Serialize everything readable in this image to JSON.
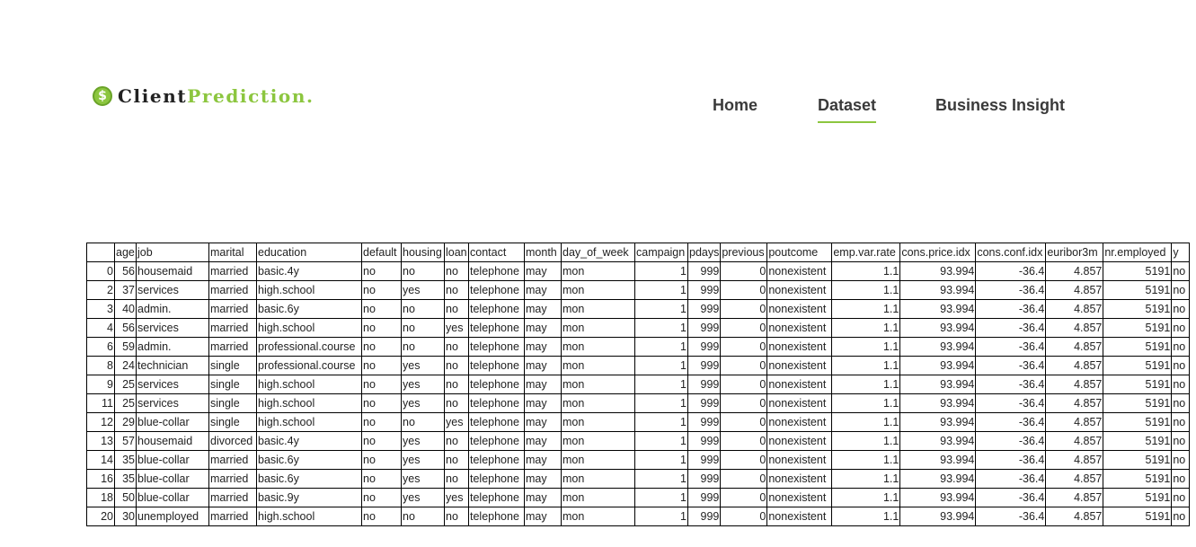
{
  "brand": {
    "part1": "Client",
    "part2": "Prediction.",
    "icon": "dollar-icon",
    "accent_color": "#8cc63f"
  },
  "nav": {
    "items": [
      {
        "label": "Home",
        "active": false
      },
      {
        "label": "Dataset",
        "active": true
      },
      {
        "label": "Business Insight",
        "active": false
      }
    ]
  },
  "table": {
    "columns": [
      "",
      "age",
      "job",
      "marital",
      "education",
      "default",
      "housing",
      "loan",
      "contact",
      "month",
      "day_of_week",
      "campaign",
      "pdays",
      "previous",
      "poutcome",
      "emp.var.rate",
      "cons.price.idx",
      "cons.conf.idx",
      "euribor3m",
      "nr.employed",
      "y"
    ],
    "rows": [
      [
        "0",
        "56",
        "housemaid",
        "married",
        "basic.4y",
        "no",
        "no",
        "no",
        "telephone",
        "may",
        "mon",
        "1",
        "999",
        "0",
        "nonexistent",
        "1.1",
        "93.994",
        "-36.4",
        "4.857",
        "5191",
        "no"
      ],
      [
        "2",
        "37",
        "services",
        "married",
        "high.school",
        "no",
        "yes",
        "no",
        "telephone",
        "may",
        "mon",
        "1",
        "999",
        "0",
        "nonexistent",
        "1.1",
        "93.994",
        "-36.4",
        "4.857",
        "5191",
        "no"
      ],
      [
        "3",
        "40",
        "admin.",
        "married",
        "basic.6y",
        "no",
        "no",
        "no",
        "telephone",
        "may",
        "mon",
        "1",
        "999",
        "0",
        "nonexistent",
        "1.1",
        "93.994",
        "-36.4",
        "4.857",
        "5191",
        "no"
      ],
      [
        "4",
        "56",
        "services",
        "married",
        "high.school",
        "no",
        "no",
        "yes",
        "telephone",
        "may",
        "mon",
        "1",
        "999",
        "0",
        "nonexistent",
        "1.1",
        "93.994",
        "-36.4",
        "4.857",
        "5191",
        "no"
      ],
      [
        "6",
        "59",
        "admin.",
        "married",
        "professional.course",
        "no",
        "no",
        "no",
        "telephone",
        "may",
        "mon",
        "1",
        "999",
        "0",
        "nonexistent",
        "1.1",
        "93.994",
        "-36.4",
        "4.857",
        "5191",
        "no"
      ],
      [
        "8",
        "24",
        "technician",
        "single",
        "professional.course",
        "no",
        "yes",
        "no",
        "telephone",
        "may",
        "mon",
        "1",
        "999",
        "0",
        "nonexistent",
        "1.1",
        "93.994",
        "-36.4",
        "4.857",
        "5191",
        "no"
      ],
      [
        "9",
        "25",
        "services",
        "single",
        "high.school",
        "no",
        "yes",
        "no",
        "telephone",
        "may",
        "mon",
        "1",
        "999",
        "0",
        "nonexistent",
        "1.1",
        "93.994",
        "-36.4",
        "4.857",
        "5191",
        "no"
      ],
      [
        "11",
        "25",
        "services",
        "single",
        "high.school",
        "no",
        "yes",
        "no",
        "telephone",
        "may",
        "mon",
        "1",
        "999",
        "0",
        "nonexistent",
        "1.1",
        "93.994",
        "-36.4",
        "4.857",
        "5191",
        "no"
      ],
      [
        "12",
        "29",
        "blue-collar",
        "single",
        "high.school",
        "no",
        "no",
        "yes",
        "telephone",
        "may",
        "mon",
        "1",
        "999",
        "0",
        "nonexistent",
        "1.1",
        "93.994",
        "-36.4",
        "4.857",
        "5191",
        "no"
      ],
      [
        "13",
        "57",
        "housemaid",
        "divorced",
        "basic.4y",
        "no",
        "yes",
        "no",
        "telephone",
        "may",
        "mon",
        "1",
        "999",
        "0",
        "nonexistent",
        "1.1",
        "93.994",
        "-36.4",
        "4.857",
        "5191",
        "no"
      ],
      [
        "14",
        "35",
        "blue-collar",
        "married",
        "basic.6y",
        "no",
        "yes",
        "no",
        "telephone",
        "may",
        "mon",
        "1",
        "999",
        "0",
        "nonexistent",
        "1.1",
        "93.994",
        "-36.4",
        "4.857",
        "5191",
        "no"
      ],
      [
        "16",
        "35",
        "blue-collar",
        "married",
        "basic.6y",
        "no",
        "yes",
        "no",
        "telephone",
        "may",
        "mon",
        "1",
        "999",
        "0",
        "nonexistent",
        "1.1",
        "93.994",
        "-36.4",
        "4.857",
        "5191",
        "no"
      ],
      [
        "18",
        "50",
        "blue-collar",
        "married",
        "basic.9y",
        "no",
        "yes",
        "yes",
        "telephone",
        "may",
        "mon",
        "1",
        "999",
        "0",
        "nonexistent",
        "1.1",
        "93.994",
        "-36.4",
        "4.857",
        "5191",
        "no"
      ],
      [
        "20",
        "30",
        "unemployed",
        "married",
        "high.school",
        "no",
        "no",
        "no",
        "telephone",
        "may",
        "mon",
        "1",
        "999",
        "0",
        "nonexistent",
        "1.1",
        "93.994",
        "-36.4",
        "4.857",
        "5191",
        "no"
      ]
    ]
  }
}
